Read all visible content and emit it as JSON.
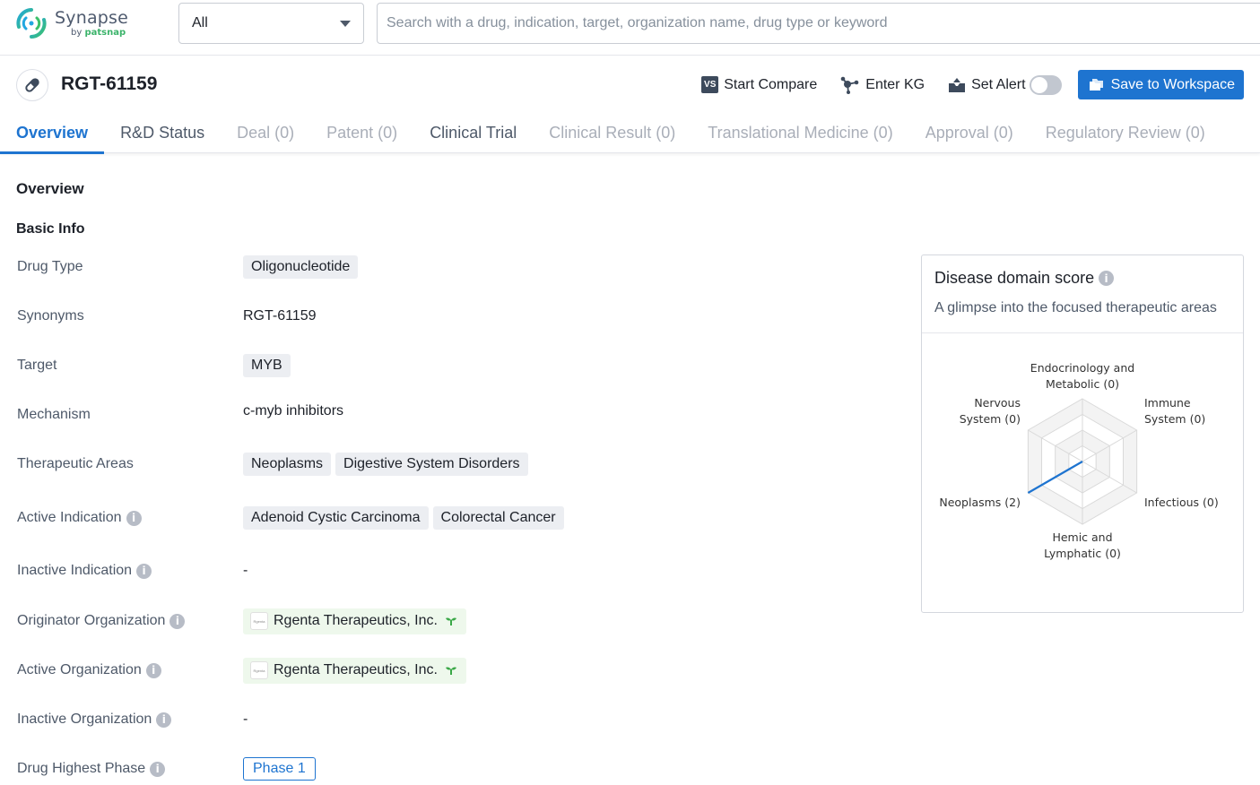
{
  "app": {
    "logo_name": "Synapse",
    "logo_by": "by",
    "logo_brand": "patsnap"
  },
  "search": {
    "scope_value": "All",
    "placeholder": "Search with a drug, indication, target, organization name, drug type or keyword",
    "value": ""
  },
  "drug": {
    "title": "RGT-61159",
    "icon": "pill-icon"
  },
  "actions": {
    "compare_label": "Start Compare",
    "compare_badge": "VS",
    "kg_label": "Enter KG",
    "alert_label": "Set Alert",
    "alert_enabled": false,
    "save_label": "Save to Workspace"
  },
  "tabs": [
    {
      "label": "Overview",
      "state": "active"
    },
    {
      "label": "R&D Status",
      "state": "enabled"
    },
    {
      "label": "Deal (0)",
      "state": "disabled"
    },
    {
      "label": "Patent (0)",
      "state": "disabled"
    },
    {
      "label": "Clinical Trial",
      "state": "enabled"
    },
    {
      "label": "Clinical Result (0)",
      "state": "disabled"
    },
    {
      "label": "Translational Medicine (0)",
      "state": "disabled"
    },
    {
      "label": "Approval (0)",
      "state": "disabled"
    },
    {
      "label": "Regulatory Review (0)",
      "state": "disabled"
    }
  ],
  "overview": {
    "title": "Overview",
    "basic_info_title": "Basic Info",
    "fields": {
      "drug_type": {
        "label": "Drug Type",
        "values": [
          "Oligonucleotide"
        ]
      },
      "synonyms": {
        "label": "Synonyms",
        "value": "RGT-61159"
      },
      "target": {
        "label": "Target",
        "values": [
          "MYB"
        ]
      },
      "mechanism": {
        "label": "Mechanism",
        "value": "c-myb inhibitors"
      },
      "therapeutic_areas": {
        "label": "Therapeutic Areas",
        "values": [
          "Neoplasms",
          "Digestive System Disorders"
        ]
      },
      "active_indication": {
        "label": "Active Indication",
        "values": [
          "Adenoid Cystic Carcinoma",
          "Colorectal Cancer"
        ]
      },
      "inactive_indication": {
        "label": "Inactive Indication",
        "value": "-"
      },
      "originator_org": {
        "label": "Originator Organization",
        "org": "Rgenta Therapeutics, Inc.",
        "org_logo_text": "Rgenta"
      },
      "active_org": {
        "label": "Active Organization",
        "org": "Rgenta Therapeutics, Inc.",
        "org_logo_text": "Rgenta"
      },
      "inactive_org": {
        "label": "Inactive Organization",
        "value": "-"
      },
      "highest_phase": {
        "label": "Drug Highest Phase",
        "value": "Phase 1"
      }
    }
  },
  "disease_panel": {
    "title": "Disease domain score",
    "subtitle": "A glimpse into the focused therapeutic areas"
  },
  "chart_data": {
    "type": "radar",
    "title": "Disease domain score",
    "axes": [
      {
        "line1": "Endocrinology and",
        "line2": "Metabolic (0)",
        "value": 0
      },
      {
        "line1": "Immune",
        "line2": "System (0)",
        "value": 0
      },
      {
        "line1": "Infectious (0)",
        "line2": "",
        "value": 0
      },
      {
        "line1": "Hemic and",
        "line2": "Lymphatic (0)",
        "value": 0
      },
      {
        "line1": "Neoplasms (2)",
        "line2": "",
        "value": 2
      },
      {
        "line1": "Nervous",
        "line2": "System (0)",
        "value": 0
      }
    ],
    "max": 2,
    "rings": 4,
    "series_color": "#1e74d0"
  }
}
